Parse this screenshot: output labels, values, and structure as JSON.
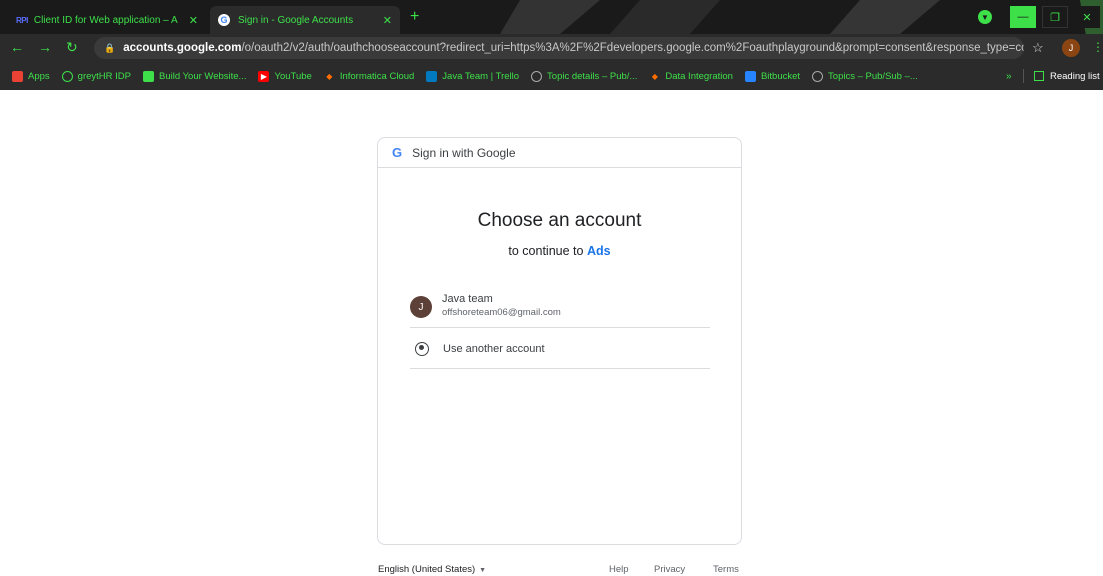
{
  "browser": {
    "tabs": [
      {
        "favicon": "RPI",
        "title": "Client ID for Web application – A"
      },
      {
        "favicon": "G",
        "title": "Sign in - Google Accounts"
      }
    ],
    "url_domain": "accounts.google.com",
    "url_rest": "/o/oauth2/v2/auth/oauthchooseaccount?redirect_uri=https%3A%2F%2Fdevelopers.google.com%2Foauthplayground&prompt=consent&response_type=co...",
    "profile_initial": "J",
    "bookmarks": [
      {
        "label": "Apps",
        "icon": "apps-grid-icon",
        "color": "#ea4335"
      },
      {
        "label": "greytHR IDP",
        "icon": "greythr-icon",
        "color": "#3ee04a"
      },
      {
        "label": "Build Your Website...",
        "icon": "builder-icon",
        "color": "#3ee04a"
      },
      {
        "label": "YouTube",
        "icon": "youtube-icon",
        "color": "#ff0000"
      },
      {
        "label": "Informatica Cloud",
        "icon": "informatica-icon",
        "color": "#ff6d00"
      },
      {
        "label": "Java Team | Trello",
        "icon": "trello-icon",
        "color": "#0079bf"
      },
      {
        "label": "Topic details – Pub/...",
        "icon": "pubsub-icon",
        "color": "#aaaaaa"
      },
      {
        "label": "Data Integration",
        "icon": "informatica-icon",
        "color": "#ff6d00"
      },
      {
        "label": "Bitbucket",
        "icon": "bitbucket-icon",
        "color": "#2684ff"
      },
      {
        "label": "Topics – Pub/Sub –...",
        "icon": "pubsub-icon",
        "color": "#aaaaaa"
      }
    ],
    "more_bookmarks": "»",
    "reading_list": "Reading list"
  },
  "signin": {
    "header": "Sign in with Google",
    "title": "Choose an account",
    "subtitle_prefix": "to continue to",
    "app_name": "Ads",
    "account": {
      "initial": "J",
      "name": "Java team",
      "email": "offshoreteam06@gmail.com"
    },
    "use_another": "Use another account"
  },
  "footer": {
    "language": "English (United States)",
    "help": "Help",
    "privacy": "Privacy",
    "terms": "Terms"
  }
}
